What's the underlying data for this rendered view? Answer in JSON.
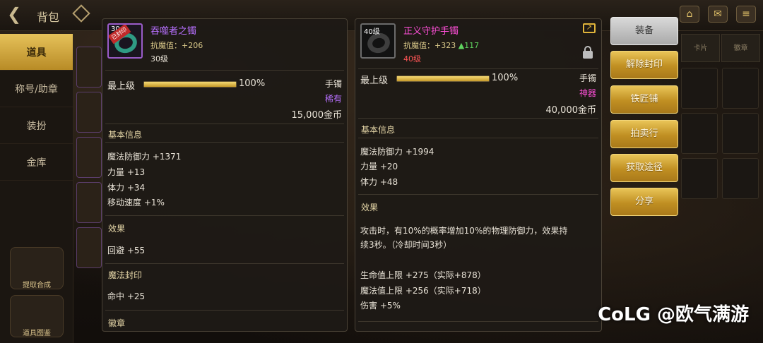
{
  "top_bar": {
    "title": "背包"
  },
  "left_nav": {
    "items": [
      {
        "label": "道具",
        "active": true
      },
      {
        "label": "称号/助章",
        "active": false
      },
      {
        "label": "装扮",
        "active": false
      },
      {
        "label": "金库",
        "active": false
      }
    ],
    "badges": [
      "提取合成",
      "道具图鉴"
    ]
  },
  "left_item": {
    "name": "吞噬者之镯",
    "icon": "jade-bracelet-icon",
    "icon_level": "30",
    "icon_tag": "已封印",
    "sub_label": "抗魔值：",
    "sub_value": "+206",
    "level": "30级",
    "grade_label": "最上级",
    "grade_fill": 1.0,
    "grade_pct": "100%",
    "slot_type": "手镯",
    "rarity": "稀有",
    "price": "15,000金币",
    "sections": {
      "basic_title": "基本信息",
      "basic_stats": [
        "魔法防御力 +1371",
        "力量 +13",
        "体力 +34",
        "移动速度 +1%"
      ],
      "effect_title": "效果",
      "effect_stats": [
        "回避 +55"
      ],
      "seal_title": "魔法封印",
      "seal_stats": [
        "命中 +25"
      ],
      "emblem_title": "徽章"
    }
  },
  "right_item": {
    "name": "正义守护手镯",
    "icon": "dark-bracelet-icon",
    "icon_level": "40级",
    "sub_label": "抗魔值：",
    "sub_value": "+323",
    "sub_up": "▲117",
    "level": "40级",
    "grade_label": "最上级",
    "grade_fill": 1.0,
    "grade_pct": "100%",
    "slot_type": "手镯",
    "rarity": "神器",
    "price": "40,000金币",
    "sections": {
      "basic_title": "基本信息",
      "basic_stats": [
        "魔法防御力 +1994",
        "力量 +20",
        "体力 +48"
      ],
      "effect_title": "效果",
      "effect_text_1": "攻击时，有10%的概率增加10%的物理防御力，效果持",
      "effect_text_2": "续3秒。（冷却时间3秒）",
      "effect_stats": [
        "生命值上限 +275（实际+878）",
        "魔法值上限 +256（实际+718）",
        "伤害 +5%"
      ]
    }
  },
  "buttons": [
    {
      "label": "装备",
      "style": "gray"
    },
    {
      "label": "解除封印",
      "style": "gold"
    },
    {
      "label": "铁匠铺",
      "style": "gold"
    },
    {
      "label": "拍卖行",
      "style": "gold"
    },
    {
      "label": "获取途径",
      "style": "gold"
    },
    {
      "label": "分享",
      "style": "gold"
    }
  ],
  "grid_tabs": [
    "卡片",
    "徽章"
  ],
  "watermark": "CoLG @欧气满游",
  "colors": {
    "rare": "#b870ff",
    "epic": "#ff4fd8",
    "gold_button": "#c08f22",
    "stat_up": "#5fd45f",
    "level_req_fail": "#ff5555"
  }
}
